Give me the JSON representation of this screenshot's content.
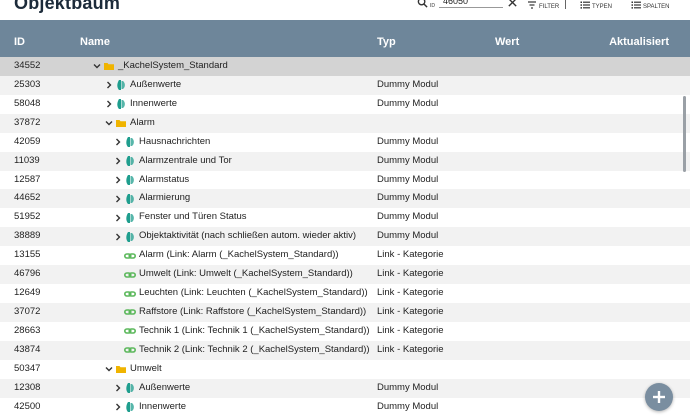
{
  "header": {
    "title": "Objektbaum",
    "id_label": "ID",
    "search_value": "46050",
    "filter_label": "FILTER",
    "typen_label": "TYPEN",
    "spalten_label": "SPALTEN"
  },
  "columns": {
    "id": "ID",
    "name": "Name",
    "typ": "Typ",
    "wert": "Wert",
    "aktualisiert": "Aktualisiert"
  },
  "colors": {
    "header_bg": "#6e869a",
    "folder": "#f0b400",
    "module": "#1f9e8e",
    "link": "#5cb85c"
  },
  "rows": [
    {
      "id": "34552",
      "name": "_KachelSystem_Standard",
      "typ": "",
      "icon": "folder-icon",
      "chevron": "down",
      "level": 0
    },
    {
      "id": "25303",
      "name": "Außenwerte",
      "typ": "Dummy Modul",
      "icon": "module-icon",
      "chevron": "right",
      "level": 1
    },
    {
      "id": "58048",
      "name": "Innenwerte",
      "typ": "Dummy Modul",
      "icon": "module-icon",
      "chevron": "right",
      "level": 1
    },
    {
      "id": "37872",
      "name": "Alarm",
      "typ": "",
      "icon": "folder-icon",
      "chevron": "down",
      "level": 1
    },
    {
      "id": "42059",
      "name": "Hausnachrichten",
      "typ": "Dummy Modul",
      "icon": "module-icon",
      "chevron": "right",
      "level": 2
    },
    {
      "id": "11039",
      "name": "Alarmzentrale und Tor",
      "typ": "Dummy Modul",
      "icon": "module-icon",
      "chevron": "right",
      "level": 2
    },
    {
      "id": "12587",
      "name": "Alarmstatus",
      "typ": "Dummy Modul",
      "icon": "module-icon",
      "chevron": "right",
      "level": 2
    },
    {
      "id": "44652",
      "name": "Alarmierung",
      "typ": "Dummy Modul",
      "icon": "module-icon",
      "chevron": "right",
      "level": 2
    },
    {
      "id": "51952",
      "name": "Fenster und Türen Status",
      "typ": "Dummy Modul",
      "icon": "module-icon",
      "chevron": "right",
      "level": 2
    },
    {
      "id": "38889",
      "name": "Objektaktivität (nach schließen autom. wieder aktiv)",
      "typ": "Dummy Modul",
      "icon": "module-icon",
      "chevron": "right",
      "level": 2
    },
    {
      "id": "13155",
      "name": "Alarm (Link: Alarm (_KachelSystem_Standard))",
      "typ": "Link - Kategorie",
      "icon": "link-icon",
      "chevron": "none",
      "level": 2
    },
    {
      "id": "46796",
      "name": "Umwelt (Link: Umwelt (_KachelSystem_Standard))",
      "typ": "Link - Kategorie",
      "icon": "link-icon",
      "chevron": "none",
      "level": 2
    },
    {
      "id": "12649",
      "name": "Leuchten (Link: Leuchten (_KachelSystem_Standard))",
      "typ": "Link - Kategorie",
      "icon": "link-icon",
      "chevron": "none",
      "level": 2
    },
    {
      "id": "37072",
      "name": "Raffstore (Link: Raffstore (_KachelSystem_Standard))",
      "typ": "Link - Kategorie",
      "icon": "link-icon",
      "chevron": "none",
      "level": 2
    },
    {
      "id": "28663",
      "name": "Technik 1 (Link: Technik 1 (_KachelSystem_Standard))",
      "typ": "Link - Kategorie",
      "icon": "link-icon",
      "chevron": "none",
      "level": 2
    },
    {
      "id": "43874",
      "name": "Technik 2 (Link: Technik 2 (_KachelSystem_Standard))",
      "typ": "Link - Kategorie",
      "icon": "link-icon",
      "chevron": "none",
      "level": 2
    },
    {
      "id": "50347",
      "name": "Umwelt",
      "typ": "",
      "icon": "folder-icon",
      "chevron": "down",
      "level": 1
    },
    {
      "id": "12308",
      "name": "Außenwerte",
      "typ": "Dummy Modul",
      "icon": "module-icon",
      "chevron": "right",
      "level": 2
    },
    {
      "id": "42500",
      "name": "Innenwerte",
      "typ": "Dummy Modul",
      "icon": "module-icon",
      "chevron": "right",
      "level": 2
    }
  ]
}
